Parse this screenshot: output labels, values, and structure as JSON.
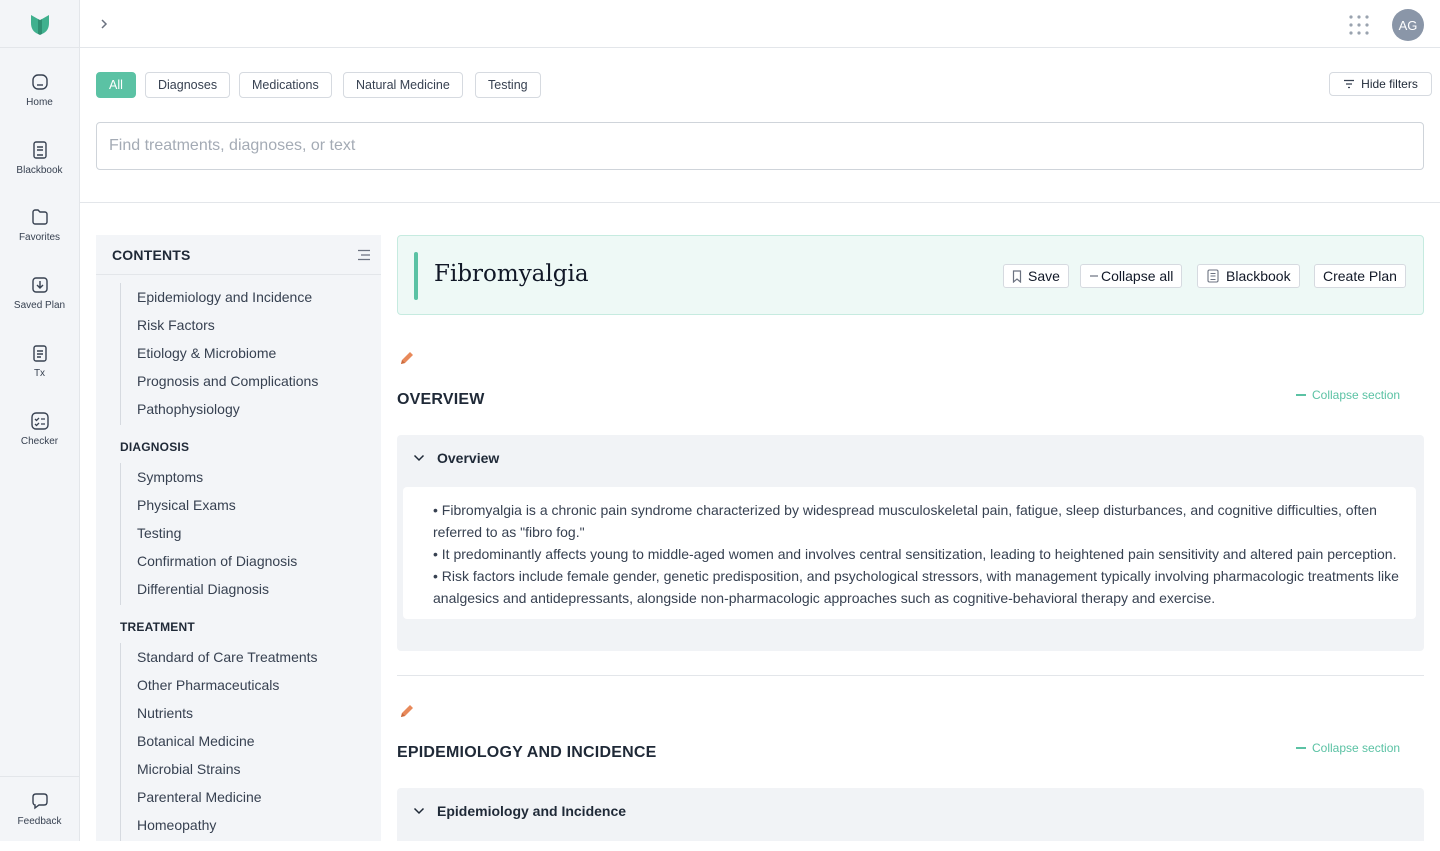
{
  "nav": {
    "items": [
      {
        "label": "Home",
        "icon": "home-icon"
      },
      {
        "label": "Blackbook",
        "icon": "book-icon"
      },
      {
        "label": "Favorites",
        "icon": "folder-icon"
      },
      {
        "label": "Saved Plan",
        "icon": "saved-plan-icon"
      },
      {
        "label": "Tx",
        "icon": "clipboard-icon"
      },
      {
        "label": "Checker",
        "icon": "checker-icon"
      }
    ],
    "feedback_label": "Feedback"
  },
  "user": {
    "initials": "AG"
  },
  "filters": {
    "chips": [
      "All",
      "Diagnoses",
      "Medications",
      "Natural Medicine",
      "Testing"
    ],
    "active": "All",
    "hide_label": "Hide filters"
  },
  "search": {
    "placeholder": "Find treatments, diagnoses, or text",
    "value": ""
  },
  "contents": {
    "title": "CONTENTS",
    "group1": [
      "Epidemiology and Incidence",
      "Risk Factors",
      "Etiology & Microbiome",
      "Prognosis and Complications",
      "Pathophysiology"
    ],
    "diagnosis_heading": "DIAGNOSIS",
    "group2": [
      "Symptoms",
      "Physical Exams",
      "Testing",
      "Confirmation of Diagnosis",
      "Differential Diagnosis"
    ],
    "treatment_heading": "TREATMENT",
    "group3": [
      "Standard of Care Treatments",
      "Other Pharmaceuticals",
      "Nutrients",
      "Botanical Medicine",
      "Microbial Strains",
      "Parenteral Medicine",
      "Homeopathy"
    ]
  },
  "page": {
    "title": "Fibromyalgia",
    "actions": {
      "save": "Save",
      "collapse_all": "Collapse all",
      "blackbook": "Blackbook",
      "create_plan": "Create Plan"
    }
  },
  "sections": {
    "overview": {
      "title": "OVERVIEW",
      "collapse_label": "Collapse section",
      "accordion_label": "Overview",
      "bullets": [
        "• Fibromyalgia is a chronic pain syndrome characterized by widespread musculoskeletal pain, fatigue, sleep disturbances, and cognitive difficulties, often referred to as \"fibro fog.\"",
        "• It predominantly affects young to middle-aged women and involves central sensitization, leading to heightened pain sensitivity and altered pain perception.",
        "• Risk factors include female gender, genetic predisposition, and psychological stressors, with management typically involving pharmacologic treatments like analgesics and antidepressants, alongside non-pharmacologic approaches such as cognitive-behavioral therapy and exercise."
      ]
    },
    "epidemiology": {
      "title": "EPIDEMIOLOGY AND INCIDENCE",
      "collapse_label": "Collapse section",
      "accordion_label": "Epidemiology and Incidence"
    }
  },
  "colors": {
    "accent": "#5bc2a4",
    "pencil": "#e8895a",
    "rail_bg": "#f3f5f8"
  }
}
